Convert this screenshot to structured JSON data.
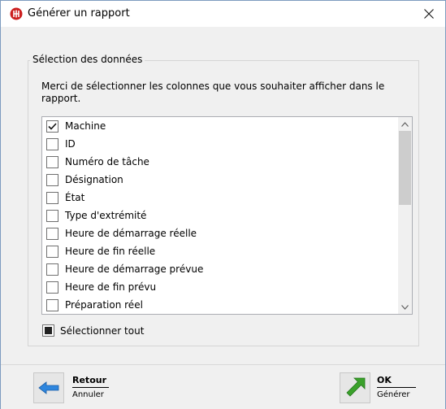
{
  "window": {
    "title": "Générer un rapport",
    "accent": "#cc1f1f",
    "close_icon": "close-icon"
  },
  "group": {
    "legend": "Sélection des données",
    "instructions": "Merci de sélectionner les colonnes que vous souhaiter afficher dans le rapport."
  },
  "columns": [
    {
      "label": "Machine",
      "checked": true
    },
    {
      "label": "ID",
      "checked": false
    },
    {
      "label": "Numéro de tâche",
      "checked": false
    },
    {
      "label": "Désignation",
      "checked": false
    },
    {
      "label": "État",
      "checked": false
    },
    {
      "label": "Type d'extrémité",
      "checked": false
    },
    {
      "label": "Heure de démarrage réelle",
      "checked": false
    },
    {
      "label": "Heure de fin réelle",
      "checked": false
    },
    {
      "label": "Heure de démarrage prévue",
      "checked": false
    },
    {
      "label": "Heure de fin prévu",
      "checked": false
    },
    {
      "label": "Préparation réel",
      "checked": false
    }
  ],
  "select_all": {
    "label": "Sélectionner tout",
    "state": "indeterminate"
  },
  "footer": {
    "back": {
      "main": "Retour",
      "sub": "Annuler",
      "icon": "arrow-left-icon",
      "color": "#2e86de"
    },
    "ok": {
      "main": "OK",
      "sub": "Générer",
      "icon": "arrow-up-right-icon",
      "color": "#3aa12a"
    }
  }
}
